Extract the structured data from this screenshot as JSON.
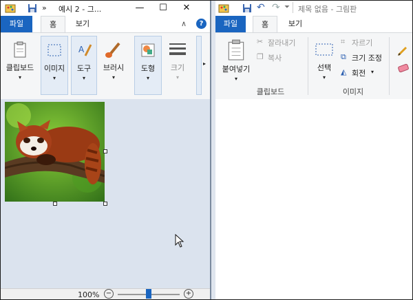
{
  "left_window": {
    "title": "예시 2 - 그...",
    "tabs": {
      "file": "파일",
      "home": "홈",
      "view": "보기"
    },
    "ribbon": {
      "clipboard": "클립보드",
      "image": "이미지",
      "tools": "도구",
      "brushes": "브러시",
      "shapes": "도형",
      "size": "크기"
    },
    "status": {
      "zoom": "100%"
    }
  },
  "right_window": {
    "title": "제목 없음 - 그림판",
    "tabs": {
      "file": "파일",
      "home": "홈",
      "view": "보기"
    },
    "ribbon": {
      "paste": "붙여넣기",
      "cut": "잘라내기",
      "copy": "복사",
      "select": "선택",
      "crop": "자르기",
      "resize": "크기 조정",
      "rotate": "회전",
      "group_clipboard": "클립보드",
      "group_image": "이미지"
    }
  },
  "colors": {
    "accent": "#1a65c0",
    "canvas_bg": "#dbe3ee",
    "ribbon_bg": "#f5f6f7"
  },
  "icons": [
    "paint-app-icon",
    "save-icon",
    "overflow-icon",
    "minimize-icon",
    "maximize-icon",
    "undo-icon",
    "redo-icon",
    "help-icon",
    "collapse-ribbon-icon",
    "clipboard-icon",
    "select-rect-icon",
    "tools-icon",
    "brush-icon",
    "shapes-icon",
    "size-lines-icon",
    "scissors-icon",
    "copy-icon",
    "crop-icon",
    "resize-icon",
    "rotate-icon",
    "pencil-icon",
    "eraser-icon",
    "mouse-cursor-icon",
    "zoom-out-icon",
    "zoom-in-icon"
  ]
}
